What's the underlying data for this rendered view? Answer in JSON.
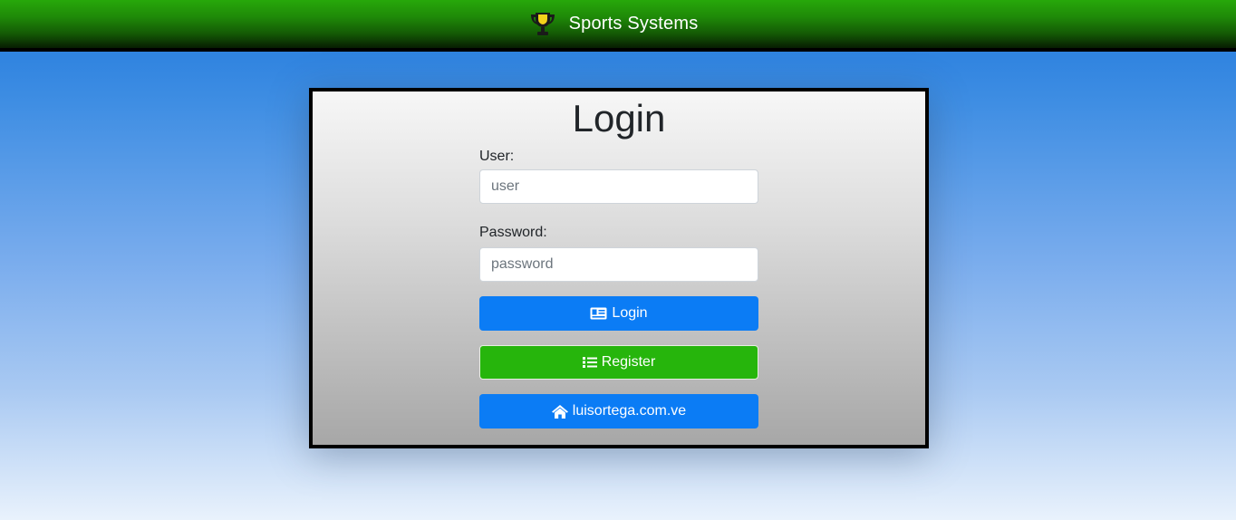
{
  "header": {
    "brand_title": "Sports Systems",
    "brand_icon": "trophy-icon"
  },
  "login": {
    "title": "Login",
    "user_label": "User:",
    "user_placeholder": "user",
    "password_label": "Password:",
    "password_placeholder": "password",
    "login_button": "Login",
    "login_icon": "id-card-icon",
    "register_button": "Register",
    "register_icon": "list-icon",
    "site_button": "luisortega.com.ve",
    "site_icon": "home-icon"
  },
  "colors": {
    "primary": "#0b7cf5",
    "success": "#26b50c",
    "header_green": "#1f8a08"
  }
}
